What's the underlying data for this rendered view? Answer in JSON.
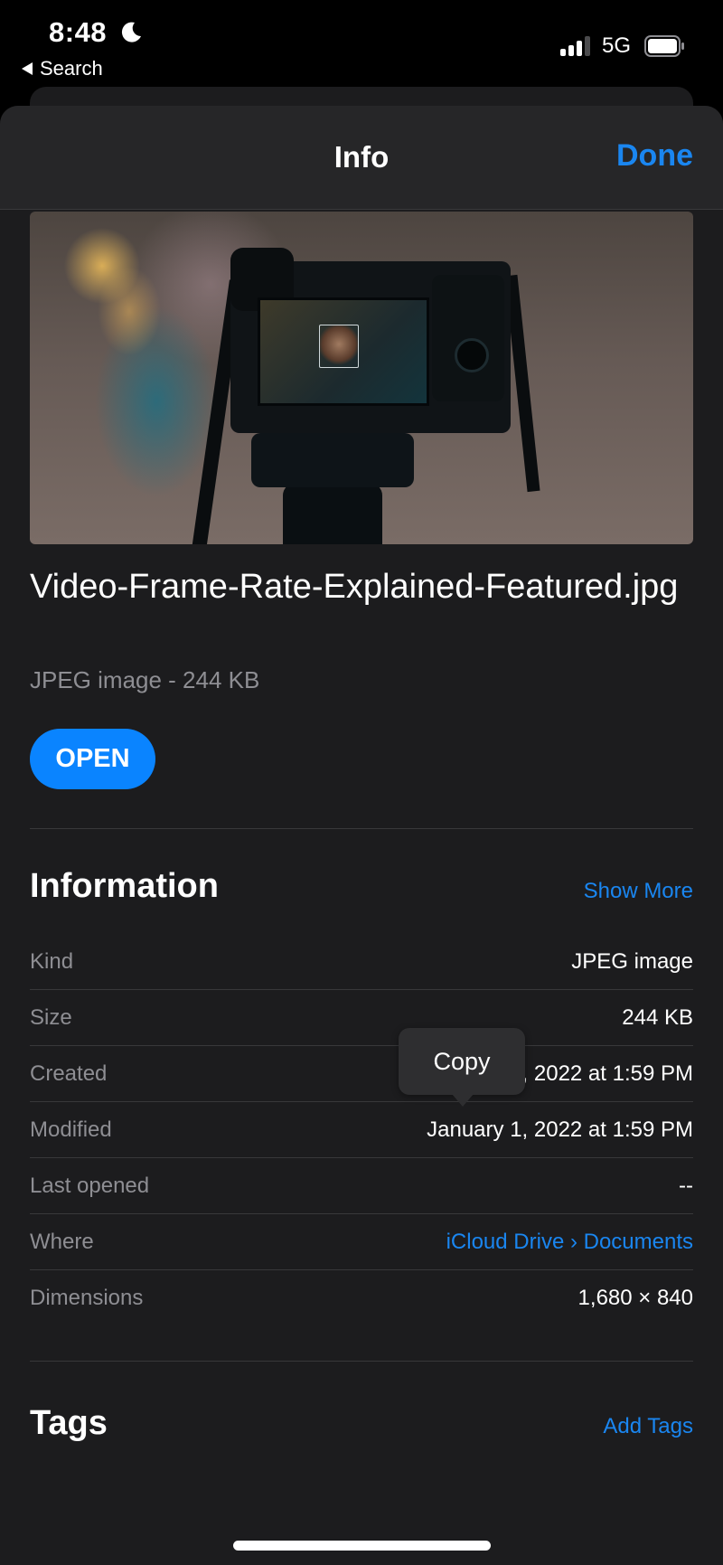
{
  "status_bar": {
    "time": "8:48",
    "focus_icon": "moon-icon",
    "back_app_label": "Search",
    "network": "5G",
    "signal_bars": 3,
    "signal_bars_total": 4,
    "battery_icon": "battery-icon"
  },
  "header": {
    "title": "Info",
    "done_label": "Done"
  },
  "preview": {
    "description": "Mirrorless camera on tripod with rear screen showing a portrait"
  },
  "file": {
    "name": "Video-Frame-Rate-Explained-Featured.jpg",
    "subtitle": "JPEG image - 244 KB",
    "open_label": "OPEN"
  },
  "information": {
    "title": "Information",
    "show_more_label": "Show More",
    "rows": [
      {
        "label": "Kind",
        "value": "JPEG image"
      },
      {
        "label": "Size",
        "value": "244 KB"
      },
      {
        "label": "Created",
        "value": "January 1, 2022 at 1:59 PM"
      },
      {
        "label": "Modified",
        "value": "January 1, 2022 at 1:59 PM"
      },
      {
        "label": "Last opened",
        "value": "--"
      },
      {
        "label": "Where",
        "value": "iCloud Drive › Documents"
      },
      {
        "label": "Dimensions",
        "value": "1,680 × 840"
      }
    ]
  },
  "copy_popup": {
    "label": "Copy"
  },
  "tags": {
    "title": "Tags",
    "add_label": "Add Tags"
  },
  "colors": {
    "accent": "#0a84ff",
    "link": "#1a86f0",
    "sheet_bg": "#1c1c1e",
    "header_bg": "#262628",
    "secondary_text": "#8e8e93"
  }
}
